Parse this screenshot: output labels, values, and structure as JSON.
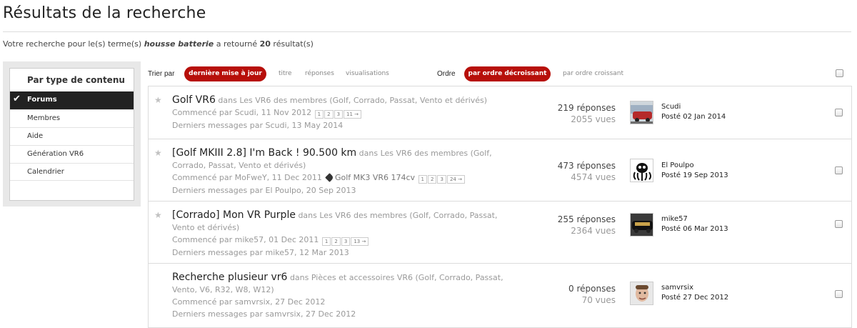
{
  "page_title": "Résultats de la recherche",
  "summary": {
    "prefix": "Votre recherche pour le(s) terme(s) ",
    "term": "housse batterie",
    "middle": " a retourné ",
    "count": "20",
    "suffix": " résultat(s)"
  },
  "sidebar": {
    "title": "Par type de contenu",
    "items": [
      {
        "label": "Forums",
        "active": true
      },
      {
        "label": "Membres"
      },
      {
        "label": "Aide"
      },
      {
        "label": "Génération VR6"
      },
      {
        "label": "Calendrier"
      }
    ]
  },
  "sort": {
    "sort_label": "Trier par",
    "options": [
      "dernière mise à jour",
      "titre",
      "réponses",
      "visualisations"
    ],
    "order_label": "Ordre",
    "order_options": [
      "par ordre décroissant",
      "par ordre croissant"
    ]
  },
  "results": [
    {
      "title": "Golf VR6",
      "forum": "dans Les VR6 des membres (Golf, Corrado, Passat, Vento et dérivés)",
      "started": "Commencé par Scudi, 11 Nov 2012",
      "pages": [
        "1",
        "2",
        "3",
        "11 →"
      ],
      "tag": "",
      "last": "Derniers messages par Scudi, 13 May 2014",
      "replies": "219 réponses",
      "views": "2055 vues",
      "last_user": "Scudi",
      "last_date": "Posté 02 Jan 2014"
    },
    {
      "title": "[Golf MKIII 2.8] I'm Back ! 90.500 km",
      "forum": "dans Les VR6 des membres (Golf, Corrado, Passat, Vento et dérivés)",
      "started": "Commencé par MoFweY, 11 Dec 2011",
      "pages": [
        "1",
        "2",
        "3",
        "24 →"
      ],
      "tag": "Golf MK3 VR6 174cv",
      "last": "Derniers messages par El Poulpo, 20 Sep 2013",
      "replies": "473 réponses",
      "views": "4574 vues",
      "last_user": "El Poulpo",
      "last_date": "Posté 19 Sep 2013"
    },
    {
      "title": "[Corrado] Mon VR Purple",
      "forum": "dans Les VR6 des membres (Golf, Corrado, Passat, Vento et dérivés)",
      "started": "Commencé par mike57, 01 Dec 2011",
      "pages": [
        "1",
        "2",
        "3",
        "13 →"
      ],
      "tag": "",
      "last": "Derniers messages par mike57, 12 Mar 2013",
      "replies": "255 réponses",
      "views": "2364 vues",
      "last_user": "mike57",
      "last_date": "Posté 06 Mar 2013"
    },
    {
      "title": "Recherche plusieur vr6",
      "forum": "dans Pièces et accessoires VR6 (Golf, Corrado, Passat, Vento, V6, R32, W8, W12)",
      "started": "Commencé par samvrsix, 27 Dec 2012",
      "pages": [],
      "tag": "",
      "last": "Derniers messages par samvrsix, 27 Dec 2012",
      "replies": "0 réponses",
      "views": "70 vues",
      "last_user": "samvrsix",
      "last_date": "Posté 27 Dec 2012"
    }
  ],
  "colors": {
    "accent": "#b70f0a",
    "active_nav": "#222222"
  }
}
